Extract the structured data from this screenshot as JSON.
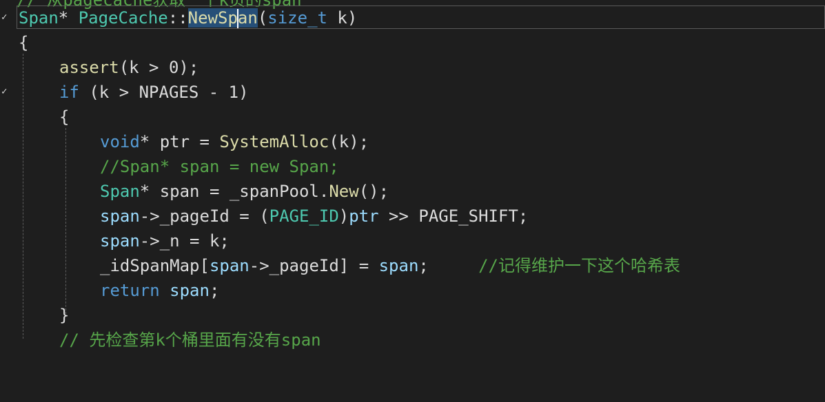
{
  "editor": {
    "top_cutoff": "// 从pagecache获取一个k页的span",
    "line1": {
      "ret_type": "Span",
      "star": "*",
      "class_name": "PageCache",
      "scope": "::",
      "fn_before_caret": "NewSp",
      "fn_after_caret": "an",
      "open": "(",
      "param_type": "size_t",
      "param_name": "k",
      "close": ")"
    },
    "line2": {
      "brace": "{"
    },
    "line3": {
      "fn": "assert",
      "args": "(k > 0);"
    },
    "line4": {
      "kw": "if",
      "cond": " (k > NPAGES - 1)"
    },
    "line5": {
      "brace": "{"
    },
    "line6": {
      "type": "void",
      "rest1": "* ptr = ",
      "fn": "SystemAlloc",
      "rest2": "(k);"
    },
    "line7": {
      "comment": "//Span* span = new Span;"
    },
    "line8": {
      "type": "Span",
      "rest1": "* span = _spanPool.",
      "fn": "New",
      "rest2": "();"
    },
    "line9": {
      "var": "span",
      "rest1": "->_pageId = (",
      "macro": "PAGE_ID",
      "rest2": ")",
      "var2": "ptr",
      "rest3": " >> PAGE_SHIFT;"
    },
    "line10": {
      "var": "span",
      "rest1": "->_n = k;"
    },
    "line11": {
      "lhs": "_idSpanMap[",
      "var": "span",
      "rest1": "->_pageId] = ",
      "var2": "span",
      "rest2": ";",
      "spacer": "     ",
      "comment": "//记得维护一下这个哈希表"
    },
    "line12": {
      "kw": "return",
      "var": " span",
      "rest": ";"
    },
    "line13": {
      "brace": "}"
    },
    "line14": {
      "comment": "// 先检查第k个桶里面有没有span"
    },
    "gutter_marks": [
      "✓",
      "✓"
    ]
  }
}
